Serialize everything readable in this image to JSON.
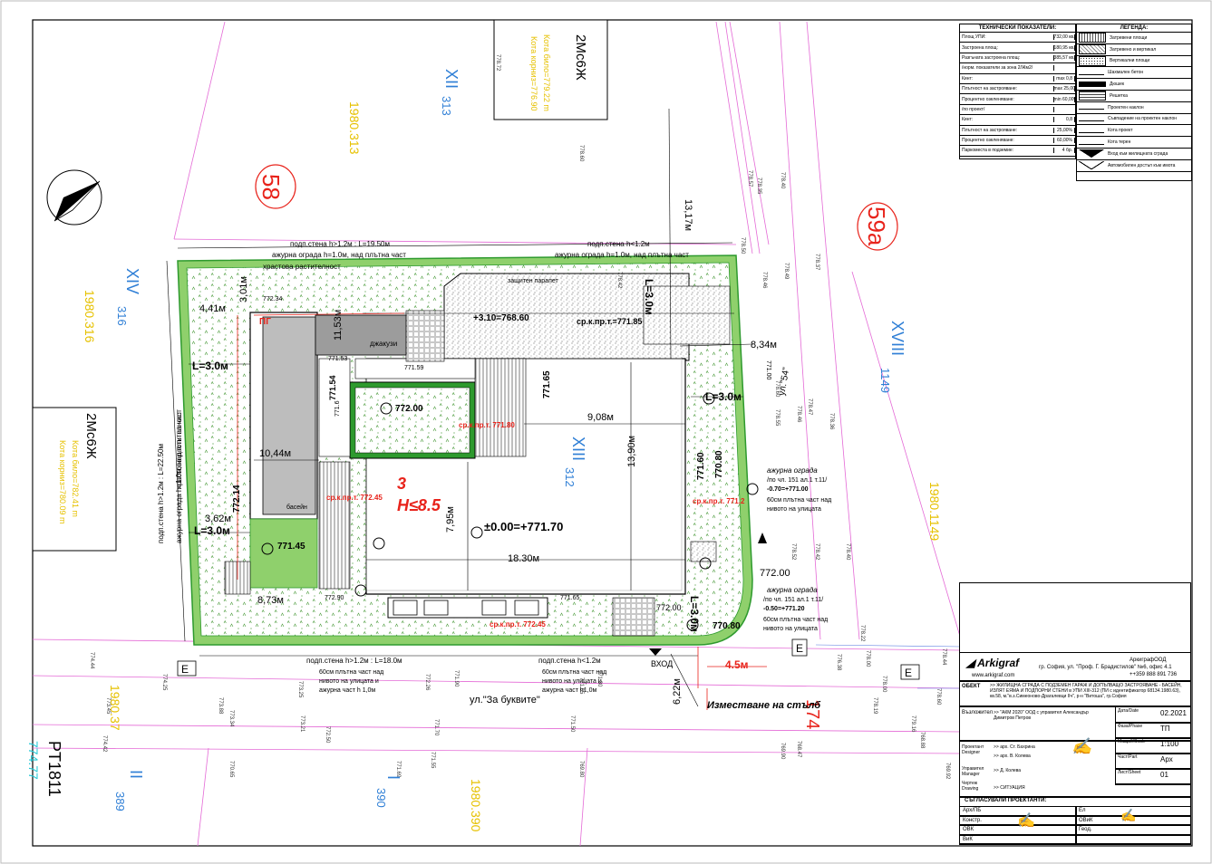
{
  "colors": {
    "green": "#8fd06c",
    "greenDark": "#2e9a2e",
    "hatch": "#888888",
    "red": "#e8231b",
    "blue": "#2f7fd6",
    "yellow": "#e6c100",
    "pink": "#e46ad6",
    "cyan": "#25c8d6"
  },
  "north_arrow_icon": "north-arrow-icon",
  "plots": {
    "p58": "58",
    "p59a": "59a",
    "p174": "174",
    "pt1811": "PT1811",
    "pt_elev": "774.77"
  },
  "parcel_labels": {
    "xii": "XII",
    "xii_n": "313",
    "xiv": "XIV",
    "xiv_n": "316",
    "xiii": "XIII",
    "xiii_n": "312",
    "xviii": "XVIII",
    "xviii_n": "1149",
    "i": "I",
    "i_n": "390",
    "ii": "II",
    "ii_n": "389",
    "y_1980_313": "1980.313",
    "y_1980_316": "1980.316",
    "y_1980_1149": "1980.1149",
    "y_1980_390": "1980.390",
    "y_1980_37": "1980.37"
  },
  "neighbor_boxes": {
    "top_title": "2Мс6Ж",
    "top_line1": "Кота било=779.22 m",
    "top_line2": "Кота корниз=776.90",
    "left_title": "2Мс6Ж",
    "left_line1": "Кота било=782.41 m",
    "left_line2": "Кота корниз=780.09 m"
  },
  "site": {
    "zone_no": "3",
    "height": "H≤8.5",
    "zero_level": "±0.00=+771.70",
    "garage_level": "+3.10=768.60",
    "grass_ur": "ср.к.пр.т.=771.85",
    "pool_label": "басейн",
    "jacuzzi_label": "джакузи",
    "pg_label": "ПГ",
    "entry_label": "ВХОД",
    "street_label": "ул.\"За буквите\"",
    "street_side": "ул.\"54\"",
    "relocate_label": "Изместване на стълб",
    "setback_45": "4.5м"
  },
  "dims": {
    "d1": "L=3.0м",
    "d2": "L=3.0м",
    "d3": "L=3.0м",
    "d4": "L=3.0м",
    "d5": "L=3.0м",
    "w918": "9,08м",
    "w1830": "18.30м",
    "h1390": "13,90м",
    "h795": "7,95м",
    "d1044": "10,44м",
    "d1317": "13,17м",
    "d1153": "11,53м",
    "d834": "8,34м",
    "d873": "8,73м",
    "d362": "3,62м",
    "d441": "4,41м",
    "d622": "6,22м",
    "d301": "3,01м"
  },
  "levels": {
    "l77200": "772.00",
    "l77180": "ср.к.пр.т. 771.80",
    "l77145": "771.45",
    "l77165": "771.65",
    "l77160": "771.60",
    "l77080a": "770.80",
    "l77080b": "770.80",
    "l77200b": "772.00",
    "l77200c": "772.00",
    "l77214": "772.14",
    "l77245a": "ср.к.пр.т. 772.45",
    "l77245b": "ср.к.пр.т. 772.45",
    "l7712": "ср.к.пр.т. 771.2",
    "l77234": "772.34",
    "l77153": "771.53",
    "l77159": "771.59",
    "l77154": "771.54",
    "l7716": "771.6",
    "l77290": "772.90",
    "l77265": "771.65",
    "l77100": "771.00"
  },
  "fence_notes": {
    "top1": "подп.стена h>1.2м : L=19.50м",
    "top2": "ажурна ограда h=1.0м, над плътна част",
    "top3": "храстова растителност",
    "top_r1": "подп.стена h<1.2м",
    "top_r2": "ажурна ограда h=1.0м, над плътна част",
    "left1": "подп.стена h>1.2м : L=22.50м",
    "left2": "ажурна ограда h=1.0м, над плътна част",
    "left3": "храстова растителност",
    "bot1": "подп.стена h>1.2м : L=18.0м",
    "bot2": "60см плътна част над",
    "bot3": "нивото на улицата и",
    "bot4": "ажурна част h 1,0м",
    "botr1": "подп.стена h<1.2м",
    "botr2": "60см плътна част над",
    "botr3": "нивото на улицата и",
    "botr4": "ажурна част h1,0м",
    "right1": "ажурна ограда",
    "right2": "/по чл. 151 ал.1 т.11/",
    "right3": "-0.70=+771.00",
    "right4": "60см плътна част над",
    "right5": "нивото на улицата",
    "right6": "ажурна ограда",
    "right7": "/по чл. 151 ал.1 т.11/",
    "right8": "-0.50=+771.20",
    "right9": "60см плътна част над",
    "right10": "нивото на улицата",
    "protect": "защитен парапет"
  },
  "tech": {
    "title": "ТЕХНИЧЕСКИ ПОКАЗАТЕЛИ:",
    "rows": [
      {
        "k": "Площ УПИ:",
        "v": "732,00 кв.м"
      },
      {
        "k": "Застроена площ:",
        "v": "180,95 кв.м"
      },
      {
        "k": "Разгъната застроена площ:",
        "v": "385,57 кв.м"
      },
      {
        "k": "/норм. показатели за зона 2/Жм2/",
        "v": ""
      },
      {
        "k": "Кинт:",
        "v": "max 0,8"
      },
      {
        "k": "Плътност на застрояване:",
        "v": "max 25,00%"
      },
      {
        "k": "Процентно озеленяване:",
        "v": "min 60,00%"
      },
      {
        "k": "/по проект/",
        "v": ""
      },
      {
        "k": "Кинт:",
        "v": "0,8"
      },
      {
        "k": "Плътност на застрояване:",
        "v": "25,00%"
      },
      {
        "k": "Процентно озеленяване:",
        "v": "60,00%"
      },
      {
        "k": "Паркоместа в подземие:",
        "v": "4 бр."
      }
    ]
  },
  "legend": {
    "title": "ЛЕГЕНДА:",
    "rows": [
      {
        "label": "Затревени площи"
      },
      {
        "label": "Затревено и вертикал"
      },
      {
        "label": "Вертикални площи"
      },
      {
        "label": "Шахмален бетон"
      },
      {
        "label": "Дюшек"
      },
      {
        "label": "Решетка"
      },
      {
        "label": "Проектен наклон"
      },
      {
        "label": "Съвпадение на проектен наклон"
      },
      {
        "label": "Кота проект"
      },
      {
        "label": "Кота терен"
      },
      {
        "label": "Вход към жилищната сграда"
      },
      {
        "label": "Автомобилен достъп към имота"
      }
    ]
  },
  "title_block": {
    "company": "Arkigraf",
    "company_line": "АркиграфООД",
    "address": "гр. София, ул. \"Проф. Г. Брадистилов\" №6, офис 4.1",
    "phone": "++359 888 891 736",
    "web": "www.arkigraf.com",
    "obekt_k": "ОБЕКТ",
    "obekt_v": ">> ЖИЛИЩНА СГРАДА С ПОДЗЕМЕН ГАРАЖ И ДОПЪЛВАЩО ЗАСТРОЯВАНЕ - БАСЕЙН, ИЗЛЯТ ЕЯМА И ПОДПОРНИ СТЕНИ в УПИ XIII-312 (ПИ с идентификатор 68134.1980.63), кв.58, м.\"в.з.Симеоново-Драгалевци ІІч\", р-н \"Витоша\", гр.София",
    "vazlojitel_k": "Възложител",
    "vazlojitel_v": ">> \"АКМ 2020\" ООД с управител Александър Димитров Петров",
    "date_k": "Дата/Date",
    "date_v": "02.2021",
    "phase_k": "Фаза/Phase",
    "phase_v": "ТП",
    "scale_k": "Мащаб/Scale",
    "scale_v": "1:100",
    "part_k": "Част/Part",
    "part_v": "Арх",
    "sheet_k": "Лист/Sheet",
    "sheet_v": "01",
    "designer_k": "Проектант Designer",
    "designer_v1": ">> арх. Ст. Бахрина",
    "designer_v2": ">> арх. В. Колева",
    "manager_k": "Управител Manager",
    "manager_v": ">> Д. Колева",
    "drawing_k": "Чертеж Drawing",
    "drawing_v": ">> СИТУАЦИЯ",
    "coord_title": "СЪГЛАСУВАЛИ ПРОЕКТАНТИ:",
    "coord_rows": [
      [
        "Арх/ПБ",
        "Ел"
      ],
      [
        "Констр.",
        "ОВиК"
      ],
      [
        "ОВК",
        "Геод."
      ],
      [
        "ВиК",
        ""
      ]
    ]
  },
  "grid_values": [
    "778.72",
    "778.60",
    "778.42",
    "778.40",
    "778.35",
    "778.50",
    "778.46",
    "778.49",
    "778.37",
    "778.57",
    "778.60",
    "778.46",
    "778.55",
    "778.47",
    "778.36",
    "778.52",
    "778.42",
    "778.40",
    "778.22",
    "778.00",
    "776.38",
    "778.00",
    "778.44",
    "779.16",
    "778.19",
    "778.60",
    "774.44",
    "773.45",
    "774.42",
    "774.25",
    "773.88",
    "773.34",
    "773.25",
    "773.21",
    "772.50",
    "772.26",
    "771.90",
    "771.70",
    "771.50",
    "771.30",
    "771.55",
    "771.55",
    "771.69",
    "770.65",
    "769.80",
    "769.90",
    "768.47",
    "768.88",
    "769.92"
  ]
}
